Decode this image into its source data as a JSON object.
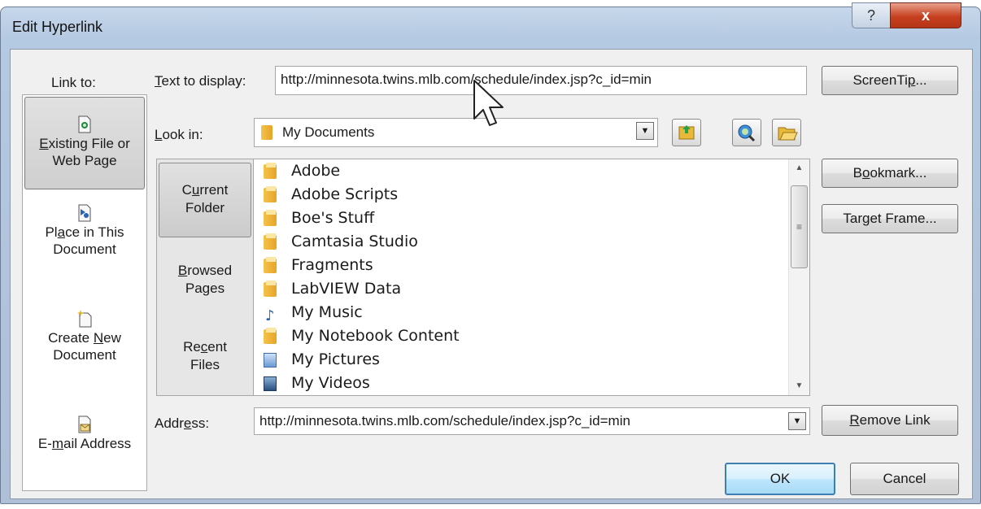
{
  "window": {
    "title": "Edit Hyperlink",
    "help_label": "?",
    "close_label": "x"
  },
  "link_to": {
    "label": "Link to:",
    "items": [
      {
        "pre": "",
        "key": "E",
        "post": "xisting File or",
        "line2": "Web Page",
        "selected": true
      },
      {
        "pre": "Pl",
        "key": "a",
        "post": "ce in This",
        "line2": "Document",
        "selected": false
      },
      {
        "pre": "Create ",
        "key": "N",
        "post": "ew",
        "line2": "Document",
        "selected": false
      },
      {
        "pre": "E-",
        "key": "m",
        "post": "ail Address",
        "line2": "",
        "selected": false
      }
    ]
  },
  "text_to_display": {
    "label_pre": "",
    "label_key": "T",
    "label_post": "ext to display:",
    "value": "http://minnesota.twins.mlb.com/schedule/index.jsp?c_id=min"
  },
  "look_in": {
    "label_pre": "",
    "label_key": "L",
    "label_post": "ook in:",
    "value": "My Documents"
  },
  "nav": [
    {
      "line1_pre": "C",
      "line1_key": "u",
      "line1_post": "rrent",
      "line2": "Folder",
      "selected": true
    },
    {
      "line1_pre": "",
      "line1_key": "B",
      "line1_post": "rowsed",
      "line2": "Pages",
      "selected": false
    },
    {
      "line1_pre": "Re",
      "line1_key": "c",
      "line1_post": "ent",
      "line2": "Files",
      "selected": false
    }
  ],
  "files": [
    {
      "name": "Adobe",
      "icon": "folder"
    },
    {
      "name": "Adobe Scripts",
      "icon": "folder"
    },
    {
      "name": "Boe's Stuff",
      "icon": "folder"
    },
    {
      "name": "Camtasia Studio",
      "icon": "folder"
    },
    {
      "name": "Fragments",
      "icon": "folder"
    },
    {
      "name": "LabVIEW Data",
      "icon": "folder"
    },
    {
      "name": "My Music",
      "icon": "music-folder"
    },
    {
      "name": "My Notebook Content",
      "icon": "folder"
    },
    {
      "name": "My Pictures",
      "icon": "pictures-folder"
    },
    {
      "name": "My Videos",
      "icon": "videos-folder"
    }
  ],
  "address": {
    "label_pre": "Addr",
    "label_key": "e",
    "label_post": "ss:",
    "value": "http://minnesota.twins.mlb.com/schedule/index.jsp?c_id=min"
  },
  "buttons": {
    "screentip_pre": "ScreenTi",
    "screentip_key": "p",
    "screentip_post": "...",
    "bookmark_pre": "B",
    "bookmark_key": "o",
    "bookmark_post": "okmark...",
    "target_pre": "Tar",
    "target_key": "g",
    "target_post": "et Frame...",
    "remove_pre": "",
    "remove_key": "R",
    "remove_post": "emove Link",
    "ok": "OK",
    "cancel": "Cancel"
  }
}
